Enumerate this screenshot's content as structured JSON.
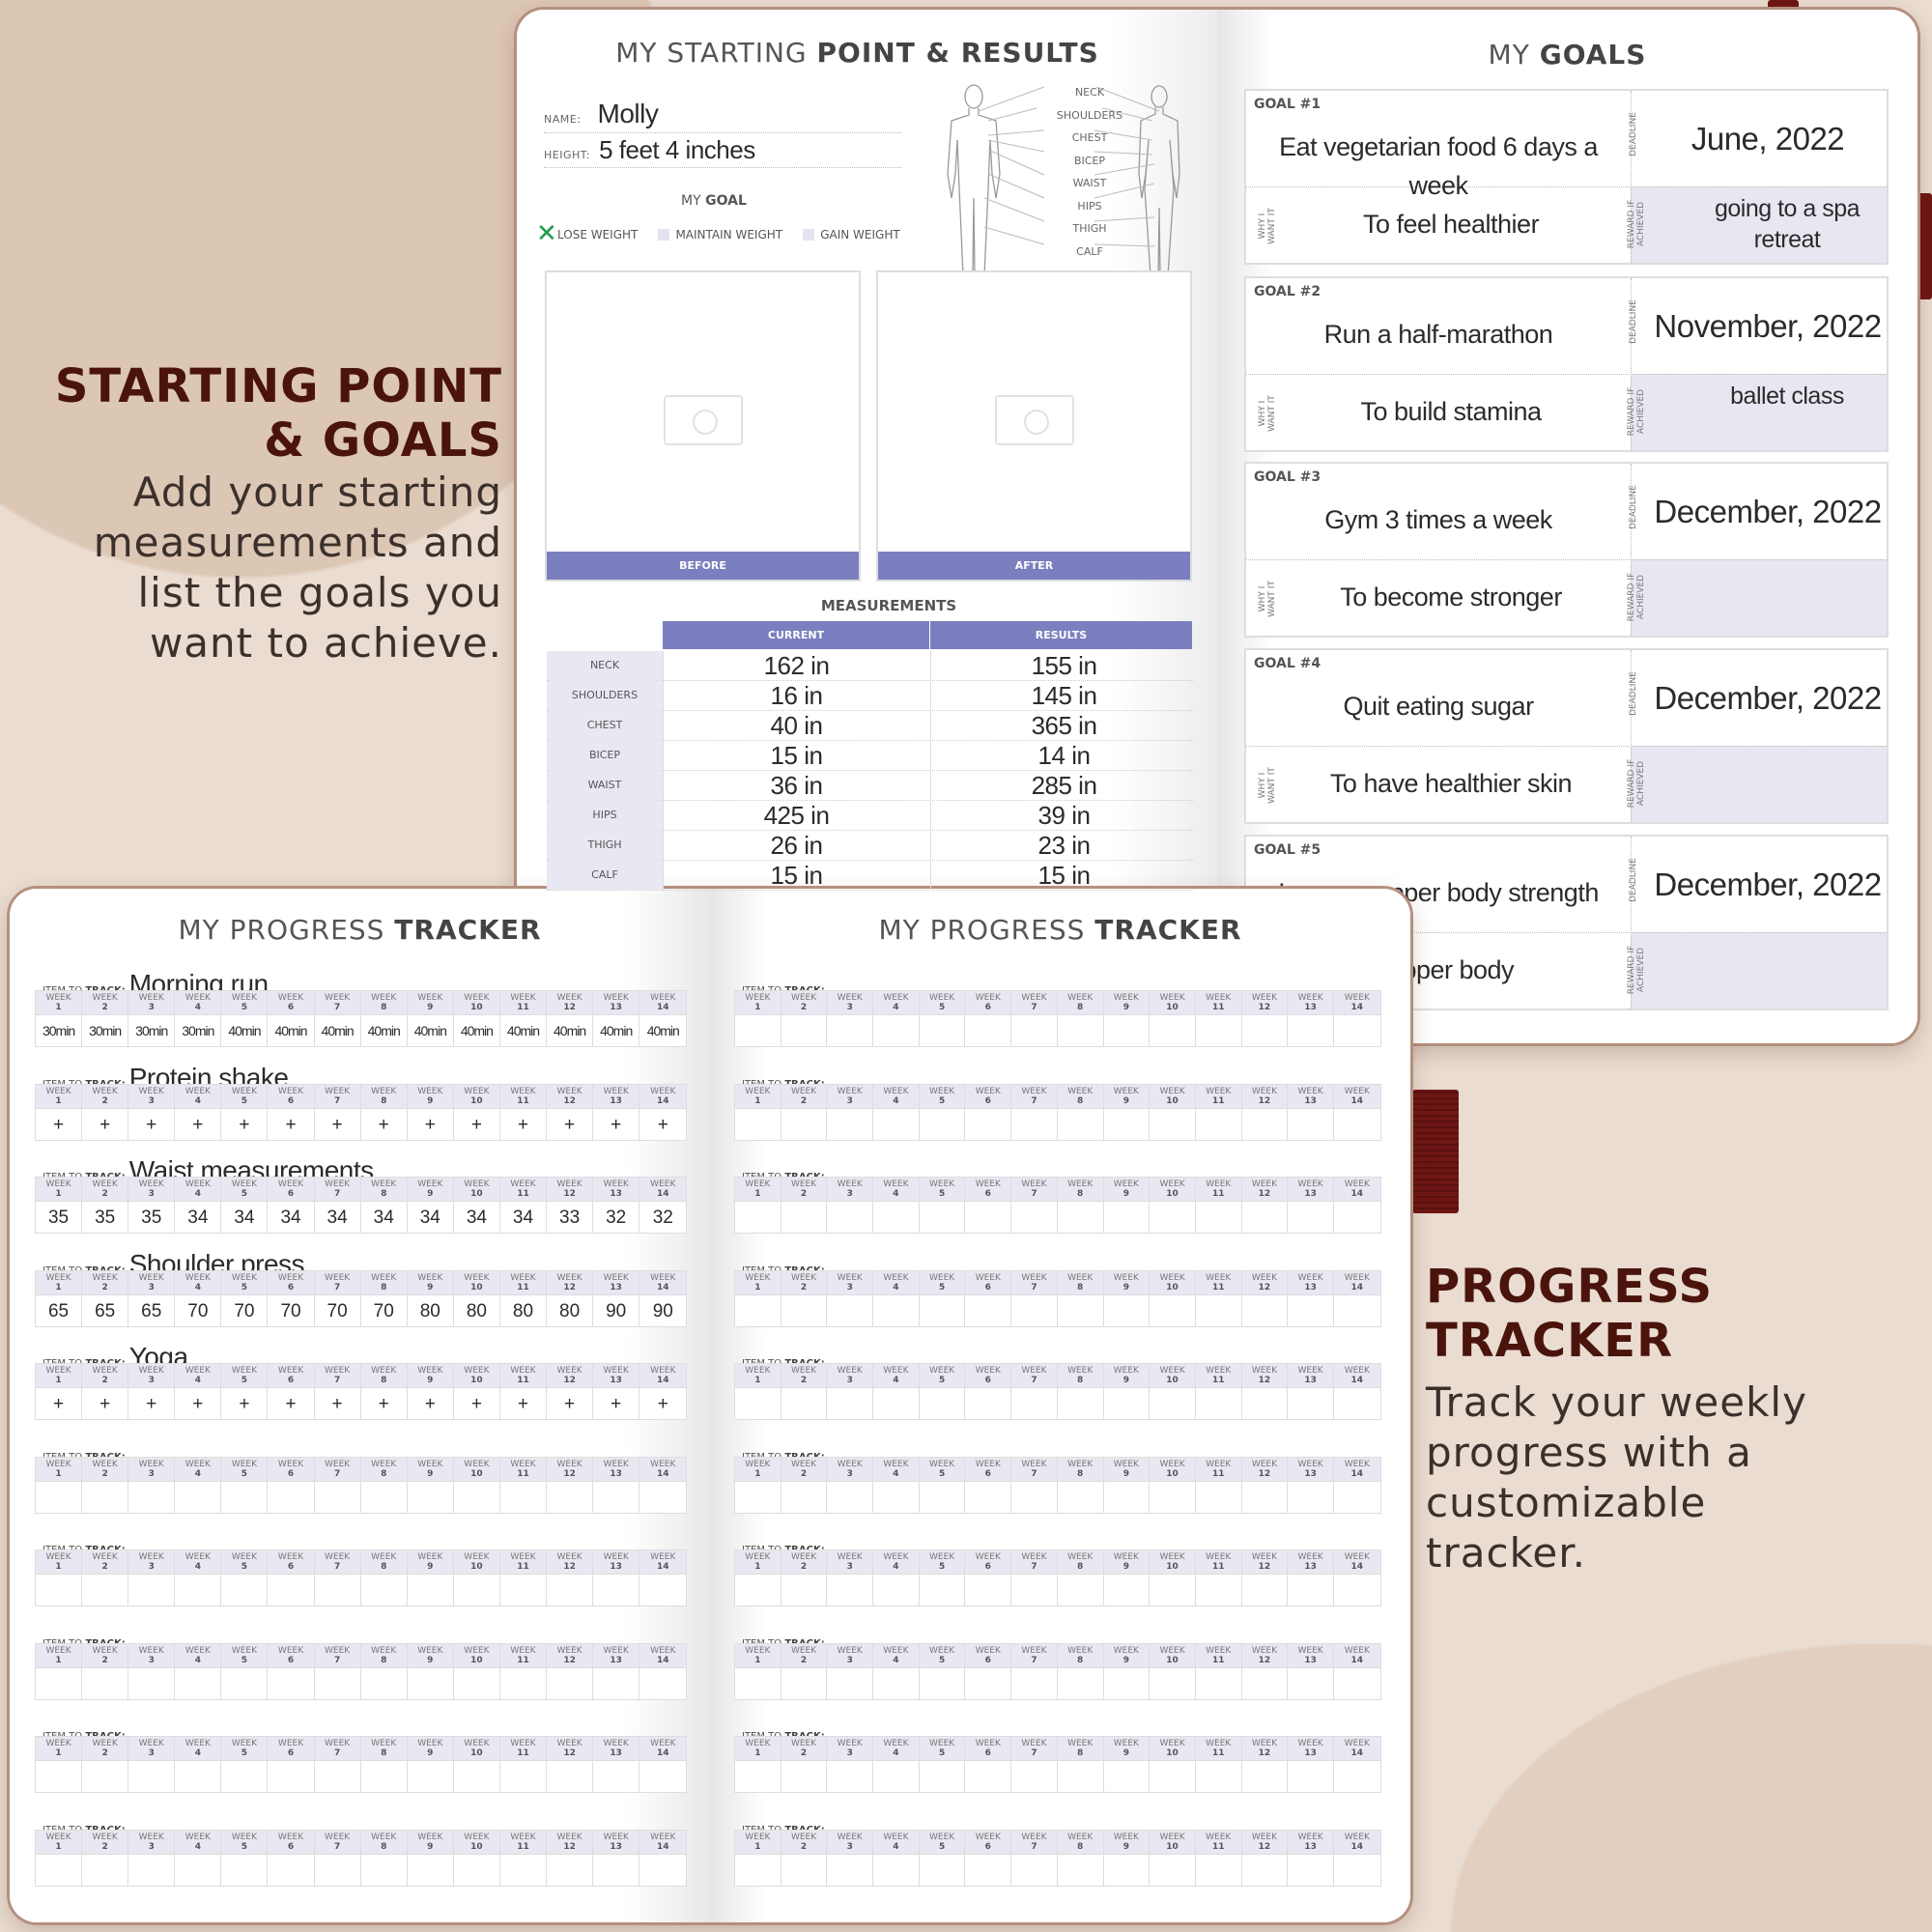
{
  "colors": {
    "accent": "#7b7fbf",
    "lavender": "#e8e8f2",
    "heading": "#4a140d",
    "ribbon": "#6e1714",
    "background": "#eadcd0",
    "check_mark": "#1e9a4a"
  },
  "side_left": {
    "heading_1": "STARTING POINT",
    "heading_2": "& GOALS",
    "body": [
      "Add your starting",
      "measurements and",
      "list the goals you",
      "want to achieve."
    ]
  },
  "side_right": {
    "heading_1": "PROGRESS",
    "heading_2": "TRACKER",
    "body": [
      "Track your weekly",
      "progress with a",
      "customizable",
      "tracker."
    ]
  },
  "starting": {
    "title_light": "MY STARTING ",
    "title_bold": "POINT & RESULTS",
    "name_label": "NAME:",
    "name_value": "Molly",
    "height_label": "HEIGHT:",
    "height_value": "5 feet 4 inches",
    "goal_title_light": "MY ",
    "goal_title_bold": "GOAL",
    "goal_options": [
      {
        "label": "LOSE WEIGHT",
        "checked": true
      },
      {
        "label": "MAINTAIN WEIGHT",
        "checked": false
      },
      {
        "label": "GAIN WEIGHT",
        "checked": false
      }
    ],
    "body_labels": [
      "NECK",
      "SHOULDERS",
      "CHEST",
      "BICEP",
      "WAIST",
      "HIPS",
      "THIGH",
      "CALF"
    ],
    "before_label": "BEFORE",
    "after_label": "AFTER",
    "measurements_title": "MEASUREMENTS",
    "current_label": "CURRENT",
    "results_label": "RESULTS",
    "measurements": [
      {
        "part": "NECK",
        "current": "162 in",
        "result": "155 in"
      },
      {
        "part": "SHOULDERS",
        "current": "16 in",
        "result": "145 in"
      },
      {
        "part": "CHEST",
        "current": "40 in",
        "result": "365 in"
      },
      {
        "part": "BICEP",
        "current": "15 in",
        "result": "14 in"
      },
      {
        "part": "WAIST",
        "current": "36 in",
        "result": "285 in"
      },
      {
        "part": "HIPS",
        "current": "425 in",
        "result": "39 in"
      },
      {
        "part": "THIGH",
        "current": "26 in",
        "result": "23 in"
      },
      {
        "part": "CALF",
        "current": "15 in",
        "result": "15 in"
      }
    ]
  },
  "goals": {
    "title_light": "MY ",
    "title_bold": "GOALS",
    "deadline_label": "DEADLINE",
    "why_label": "WHY I WANT IT",
    "reward_label": "REWARD IF ACHIEVED",
    "items": [
      {
        "label": "GOAL #1",
        "goal": "Eat vegetarian food 6 days a week",
        "deadline": "June, 2022",
        "why": "To feel healthier",
        "reward": "going to a spa retreat"
      },
      {
        "label": "GOAL #2",
        "goal": "Run a half-marathon",
        "deadline": "November, 2022",
        "why": "To build stamina",
        "reward": "ballet class"
      },
      {
        "label": "GOAL #3",
        "goal": "Gym 3 times a week",
        "deadline": "December, 2022",
        "why": "To become stronger",
        "reward": ""
      },
      {
        "label": "GOAL #4",
        "goal": "Quit eating sugar",
        "deadline": "December, 2022",
        "why": "To have healthier skin",
        "reward": ""
      },
      {
        "label": "GOAL #5",
        "goal": "Improve upper body strength",
        "deadline": "December, 2022",
        "why": "upper body",
        "reward": ""
      }
    ]
  },
  "tracker": {
    "title_light": "MY PROGRESS ",
    "title_bold": "TRACKER",
    "item_label_light": "ITEM TO ",
    "item_label_bold": "TRACK:",
    "week_label": "WEEK",
    "weeks": [
      "1",
      "2",
      "3",
      "4",
      "5",
      "6",
      "7",
      "8",
      "9",
      "10",
      "11",
      "12",
      "13",
      "14"
    ],
    "left": [
      {
        "item": "Morning run",
        "values": [
          "30min",
          "30min",
          "30min",
          "30min",
          "40min",
          "40min",
          "40min",
          "40min",
          "40min",
          "40min",
          "40min",
          "40min",
          "40min",
          "40min"
        ]
      },
      {
        "item": "Protein shake",
        "values": [
          "+",
          "+",
          "+",
          "+",
          "+",
          "+",
          "+",
          "+",
          "+",
          "+",
          "+",
          "+",
          "+",
          "+"
        ]
      },
      {
        "item": "Waist measurements",
        "values": [
          "35",
          "35",
          "35",
          "34",
          "34",
          "34",
          "34",
          "34",
          "34",
          "34",
          "34",
          "33",
          "32",
          "32"
        ]
      },
      {
        "item": "Shoulder press",
        "values": [
          "65",
          "65",
          "65",
          "70",
          "70",
          "70",
          "70",
          "70",
          "80",
          "80",
          "80",
          "80",
          "90",
          "90"
        ]
      },
      {
        "item": "Yoga",
        "values": [
          "+",
          "+",
          "+",
          "+",
          "+",
          "+",
          "+",
          "+",
          "+",
          "+",
          "+",
          "+",
          "+",
          "+"
        ]
      },
      {
        "item": "",
        "values": []
      },
      {
        "item": "",
        "values": []
      },
      {
        "item": "",
        "values": []
      },
      {
        "item": "",
        "values": []
      },
      {
        "item": "",
        "values": []
      }
    ],
    "right": [
      {
        "item": "",
        "values": []
      },
      {
        "item": "",
        "values": []
      },
      {
        "item": "",
        "values": []
      },
      {
        "item": "",
        "values": []
      },
      {
        "item": "",
        "values": []
      },
      {
        "item": "",
        "values": []
      },
      {
        "item": "",
        "values": []
      },
      {
        "item": "",
        "values": []
      },
      {
        "item": "",
        "values": []
      },
      {
        "item": "",
        "values": []
      }
    ]
  }
}
